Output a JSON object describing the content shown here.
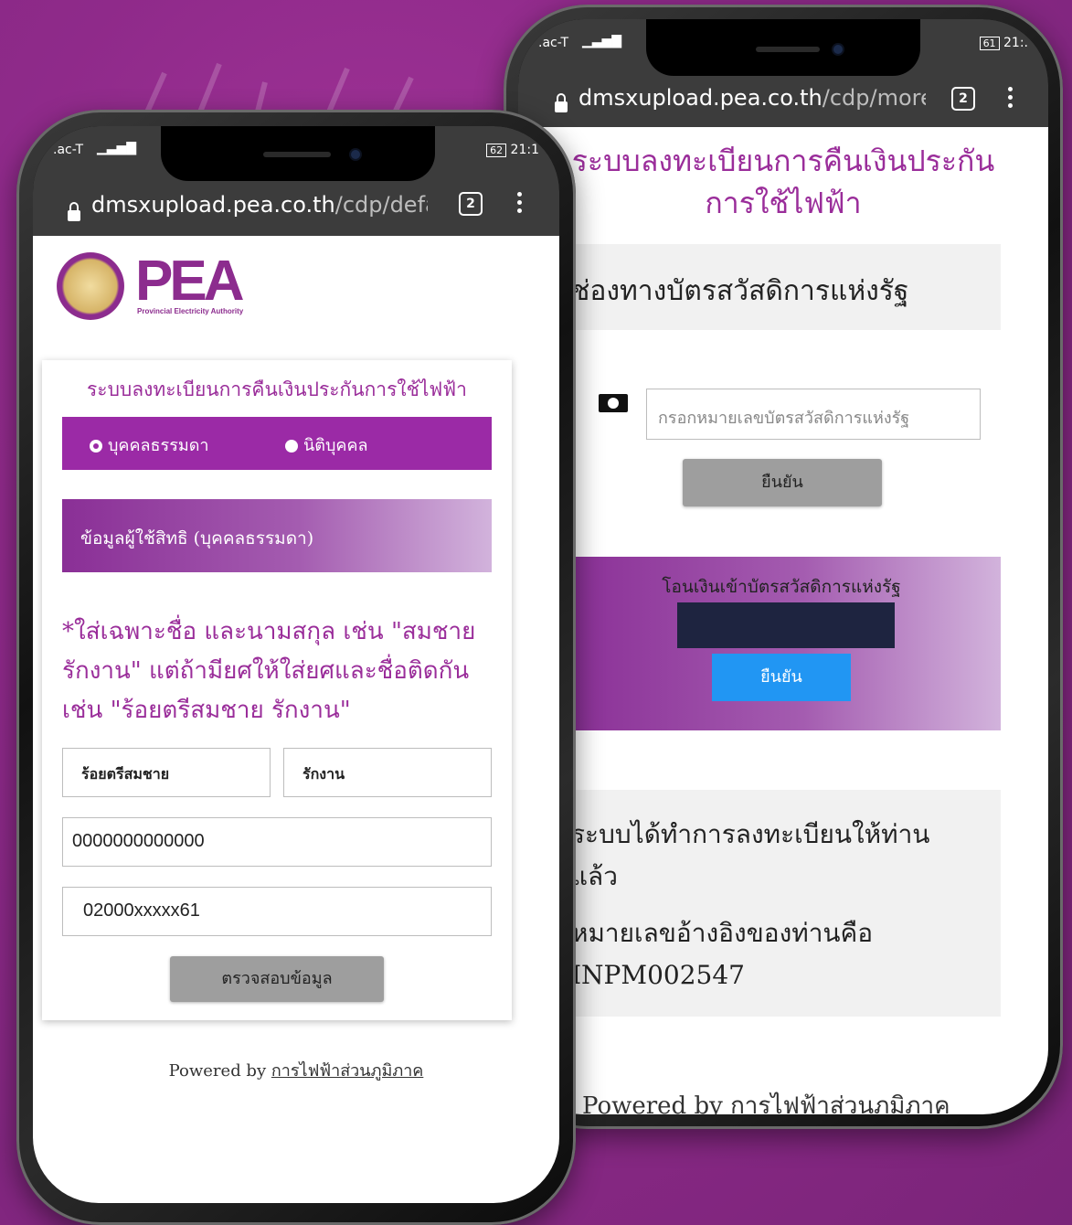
{
  "left_phone": {
    "status": {
      "carrier": ".ac-T",
      "battery": "62",
      "time": "21:1"
    },
    "address_bar": {
      "host": "dmsxupload.pea.co.th",
      "path": "/cdp/defau",
      "tab_count": "2"
    },
    "logo": {
      "text": "PEA",
      "tagline": "Provincial Electricity Authority"
    },
    "form_title": "ระบบลงทะเบียนการคืนเงินประกันการใช้ไฟฟ้า",
    "radios": [
      {
        "label": "บุคคลธรรมดา",
        "selected": true
      },
      {
        "label": "นิติบุคคล",
        "selected": false
      }
    ],
    "section_header": "ข้อมูลผู้ใช้สิทธิ (บุคคลธรรมดา)",
    "instruction": "*ใส่เฉพาะชื่อ และนามสกุล เช่น \"สมชาย รักงาน\" แต่ถ้ามียศให้ใส่ยศและชื่อติดกัน เช่น \"ร้อยตรีสมชาย รักงาน\"",
    "first_name": "ร้อยตรีสมชาย",
    "last_name": "รักงาน",
    "id_number": "0000000000000",
    "account_number": "02000xxxxx61",
    "check_button": "ตรวจสอบข้อมูล",
    "footer": {
      "prefix": "Powered by",
      "link": "การไฟฟ้าส่วนภูมิภาค"
    }
  },
  "right_phone": {
    "status": {
      "carrier": ".ac-T",
      "battery": "61",
      "time": "21:."
    },
    "address_bar": {
      "host": "dmsxupload.pea.co.th",
      "path": "/cdp/more",
      "tab_count": "2"
    },
    "title": "ระบบลงทะเบียนการคืนเงินประกันการใช้ไฟฟ้า",
    "channel_header": "ช่องทางบัตรสวัสดิการแห่งรัฐ",
    "card_input_placeholder": "กรอกหมายเลขบัตรสวัสดิการแห่งรัฐ",
    "confirm_button": "ยืนยัน",
    "transfer_header": "โอนเงินเข้าบัตรสวัสดิการแห่งรัฐ",
    "transfer_confirm_button": "ยืนยัน",
    "result_line1": "ระบบได้ทำการลงทะเบียนให้ท่านแล้ว",
    "result_line2": "หมายเลขอ้างอิงของท่านคือ INPM002547",
    "footer": {
      "prefix": "Powered by",
      "link": "การไฟฟ้าส่วนภูมิภาค"
    }
  },
  "colors": {
    "background": "#8f2a8a",
    "accent": "#9b2aa6",
    "blue_button": "#2196f3",
    "navy_block": "#1e2440"
  }
}
